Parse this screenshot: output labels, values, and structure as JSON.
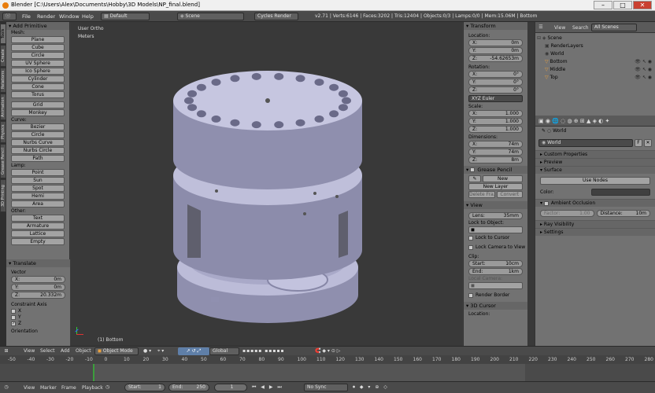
{
  "window": {
    "title": "Blender [C:\\Users\\Alex\\Documents\\Hobby\\3D Models\\NP_final.blend]",
    "minimize": "–",
    "maximize": "□",
    "close": "✕"
  },
  "infobar": {
    "menus": [
      "File",
      "Render",
      "Window",
      "Help"
    ],
    "layout": "Default",
    "scene": "Scene",
    "engine": "Cycles Render",
    "stats": "v2.71 | Verts:6146 | Faces:3202 | Tris:12404 | Objects:0/3 | Lamps:0/0 | Mem:15.06M | Bottom"
  },
  "tool_tabs": [
    "Tools",
    "Create",
    "Relations",
    "Animation",
    "Physics",
    "Grease Pencil",
    "3D Printing"
  ],
  "toolshelf": {
    "header": "Add Primitive",
    "mesh_label": "Mesh:",
    "mesh": [
      "Plane",
      "Cube",
      "Circle",
      "UV Sphere",
      "Ico Sphere",
      "Cylinder",
      "Cone",
      "Torus",
      "Grid",
      "Monkey"
    ],
    "curve_label": "Curve:",
    "curve": [
      "Bezier",
      "Circle",
      "Nurbs Curve",
      "Nurbs Circle",
      "Path"
    ],
    "lamp_label": "Lamp:",
    "lamp": [
      "Point",
      "Sun",
      "Spot",
      "Hemi",
      "Area"
    ],
    "other_label": "Other:",
    "other": [
      "Text",
      "Armature",
      "Lattice",
      "Empty"
    ],
    "translate_header": "Translate",
    "vector_label": "Vector",
    "vector": [
      {
        "k": "X:",
        "v": "0m"
      },
      {
        "k": "Y:",
        "v": "0m"
      },
      {
        "k": "Z:",
        "v": "20.332m"
      }
    ],
    "constraint_label": "Constraint Axis",
    "axes": [
      "X",
      "Y",
      "Z"
    ],
    "orientation_label": "Orientation"
  },
  "viewport": {
    "view_name": "User Ortho",
    "units": "Meters",
    "object_name": "(1) Bottom"
  },
  "npanel": {
    "transform": "Transform",
    "location": "Location:",
    "loc": [
      {
        "k": "X:",
        "v": "0m"
      },
      {
        "k": "Y:",
        "v": "0m"
      },
      {
        "k": "Z:",
        "v": "-54.62653m"
      }
    ],
    "rotation": "Rotation:",
    "rot": [
      {
        "k": "X:",
        "v": "0°"
      },
      {
        "k": "Y:",
        "v": "0°"
      },
      {
        "k": "Z:",
        "v": "0°"
      }
    ],
    "rot_mode": "XYZ Euler",
    "scale": "Scale:",
    "scl": [
      {
        "k": "X:",
        "v": "1.000"
      },
      {
        "k": "Y:",
        "v": "1.000"
      },
      {
        "k": "Z:",
        "v": "1.000"
      }
    ],
    "dimensions": "Dimensions:",
    "dim": [
      {
        "k": "X:",
        "v": "74m"
      },
      {
        "k": "Y:",
        "v": "74m"
      },
      {
        "k": "Z:",
        "v": "8m"
      }
    ],
    "grease": "Grease Pencil",
    "new": "New",
    "new_layer": "New Layer",
    "delete_frame": "Delete Fra...",
    "convert": "Convert",
    "view": "View",
    "lens_k": "Lens:",
    "lens_v": "35mm",
    "lock_obj": "Lock to Object:",
    "lock_cursor": "Lock to Cursor",
    "lock_cam": "Lock Camera to View",
    "clip": "Clip:",
    "clip_start_k": "Start:",
    "clip_start_v": "10cm",
    "clip_end_k": "End:",
    "clip_end_v": "1km",
    "local_camera": "Local Camera:",
    "render_border": "Render Border",
    "cursor": "3D Cursor",
    "cursor_loc": "Location:"
  },
  "outliner": {
    "view": "View",
    "search": "Search",
    "scenes": "All Scenes",
    "items": [
      "Scene",
      "RenderLayers",
      "World",
      "Bottom",
      "Middle",
      "Top"
    ]
  },
  "props": {
    "world_label": "World",
    "world_field": "World",
    "fbutton": "F",
    "panels": [
      "Custom Properties",
      "Preview",
      "Surface"
    ],
    "use_nodes": "Use Nodes",
    "color": "Color:",
    "ambient": "Ambient Occlusion",
    "factor_k": "Factor:",
    "factor_v": "1.00",
    "distance_k": "Distance:",
    "distance_v": "10m",
    "ray_vis": "Ray Visibility",
    "settings": "Settings"
  },
  "header3d": {
    "menus": [
      "View",
      "Select",
      "Add",
      "Object"
    ],
    "mode": "Object Mode",
    "orientation": "Global"
  },
  "timeline": {
    "ticks": [
      "-50",
      "-40",
      "-30",
      "-20",
      "-10",
      "0",
      "10",
      "20",
      "30",
      "40",
      "50",
      "60",
      "70",
      "80",
      "90",
      "100",
      "110",
      "120",
      "130",
      "140",
      "150",
      "160",
      "170",
      "180",
      "190",
      "200",
      "210",
      "220",
      "230",
      "240",
      "250",
      "260",
      "270",
      "280"
    ],
    "menus": [
      "View",
      "Marker",
      "Frame",
      "Playback"
    ],
    "start_k": "Start:",
    "start_v": "1",
    "end_k": "End:",
    "end_v": "250",
    "current": "1",
    "sync": "No Sync"
  },
  "colors": {
    "model": "#b9b9d6",
    "bg": "#393939",
    "panel": "#727272"
  }
}
